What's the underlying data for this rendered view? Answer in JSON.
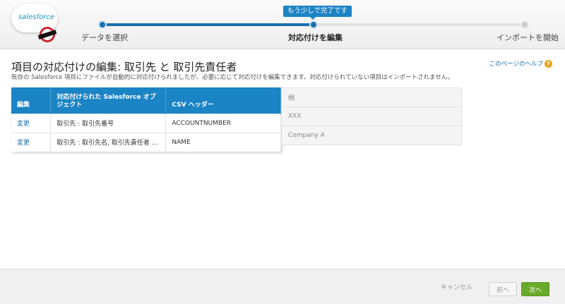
{
  "header": {
    "logo_alt": "salesforce",
    "steps": [
      {
        "label": "データを選択",
        "state": "done"
      },
      {
        "label": "対応付けを編集",
        "state": "current"
      },
      {
        "label": "インポートを開始",
        "state": "todo"
      }
    ],
    "progress_tooltip": "もう少しで完了です",
    "progress_fraction": 0.5
  },
  "page": {
    "title": "項目の対応付けの編集: 取引先 と 取引先責任者",
    "description": "既存の Salesforce 項目にファイルが自動的に対応付けられましたが、必要に応じて対応付けを編集できます。対応付けられていない項目はインポートされません。",
    "help_link": "このページのヘルプ",
    "help_icon": "question-icon"
  },
  "mapping_table": {
    "columns": [
      "編集",
      "対応付けられた Salesforce オブジェクト",
      "CSV ヘッダー"
    ],
    "rows": [
      {
        "edit": "変更",
        "object": "取引先 : 取引先番号",
        "csv": "ACCOUNTNUMBER"
      },
      {
        "edit": "変更",
        "object": "取引先 : 取引先名, 取引先責任者 : ...",
        "csv": "NAME"
      }
    ]
  },
  "example_table": {
    "header": "例",
    "rows": [
      "XXX",
      "Company A"
    ]
  },
  "footer": {
    "cancel": "キャンセル",
    "prev": "前へ",
    "next": "次へ"
  },
  "colors": {
    "accent": "#1b84c4",
    "progress": "#1b6fae",
    "next_button": "#6aaa2a"
  }
}
